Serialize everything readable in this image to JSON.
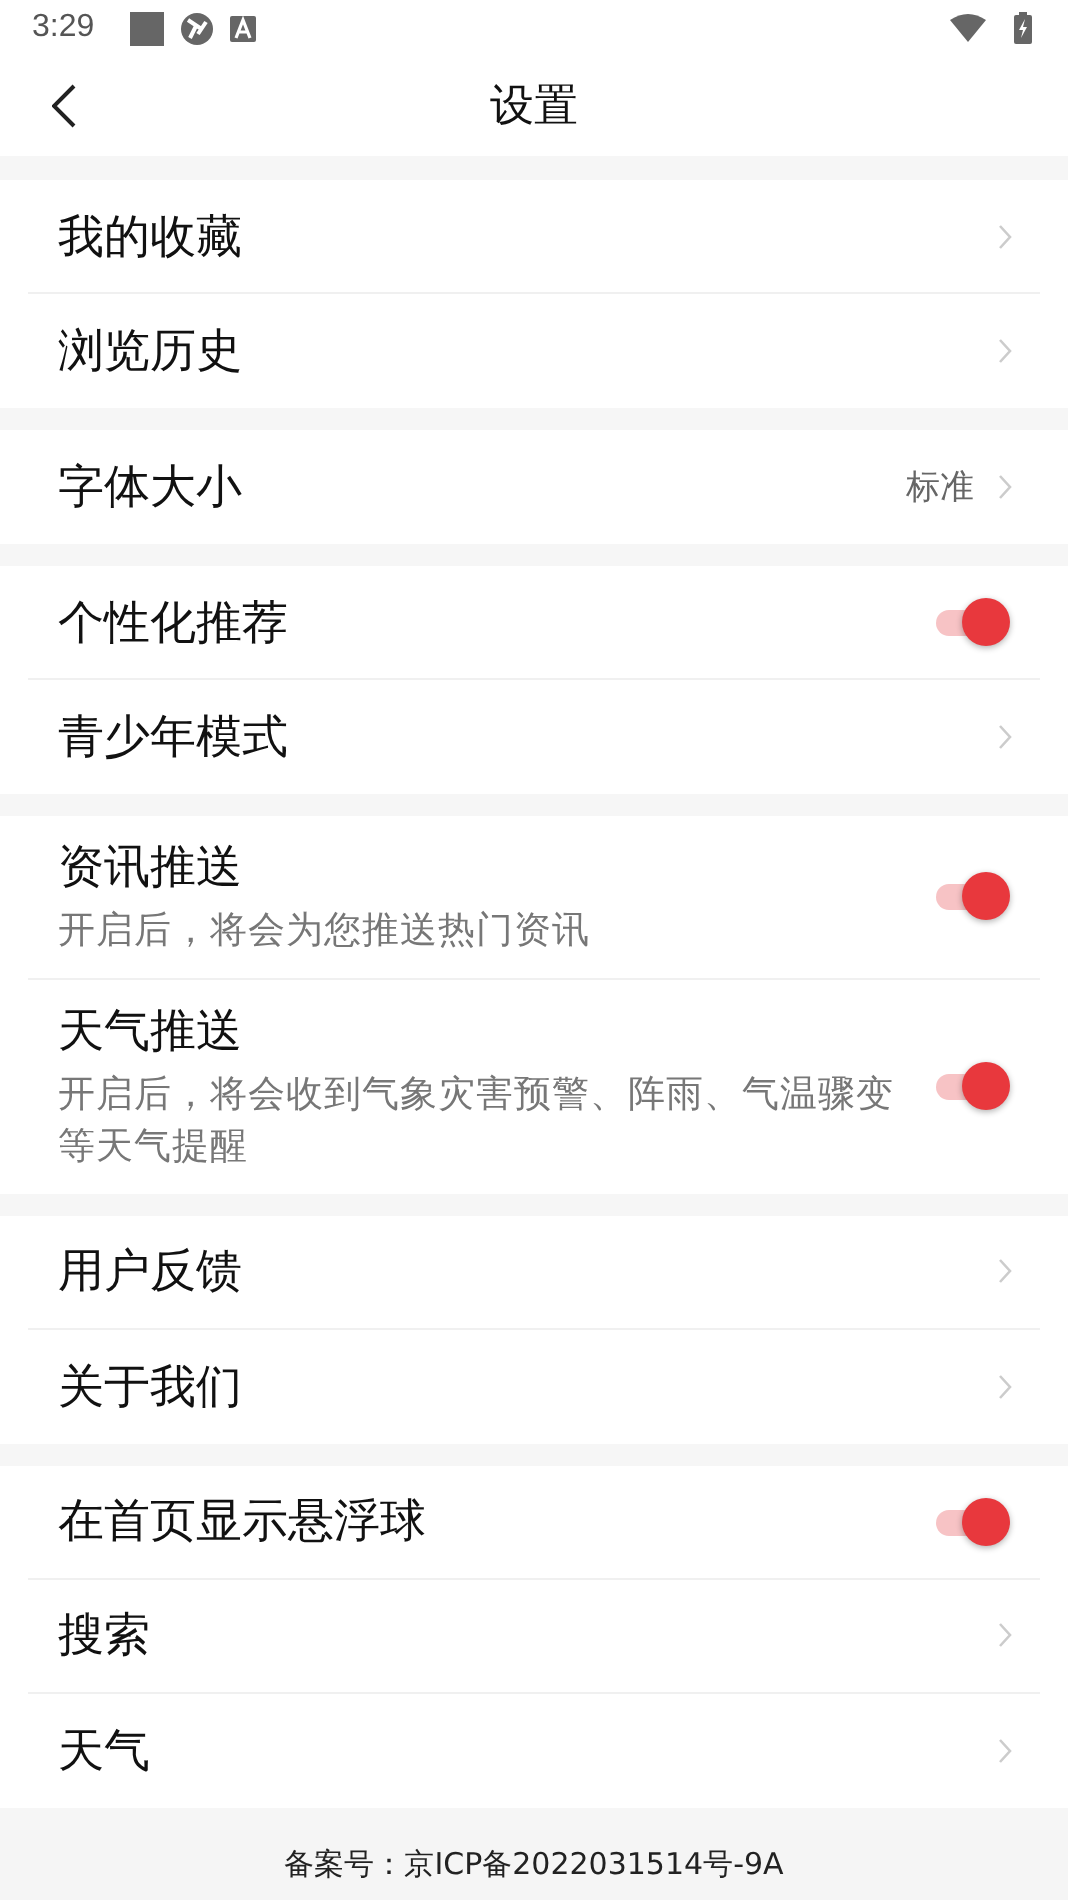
{
  "status_bar": {
    "time": "3:29"
  },
  "header": {
    "title": "设置"
  },
  "groups": [
    {
      "items": [
        {
          "kind": "link",
          "label": "我的收藏"
        },
        {
          "kind": "link",
          "label": "浏览历史"
        }
      ]
    },
    {
      "items": [
        {
          "kind": "link",
          "label": "字体大小",
          "value": "标准"
        }
      ]
    },
    {
      "items": [
        {
          "kind": "toggle",
          "label": "个性化推荐",
          "on": true
        },
        {
          "kind": "link",
          "label": "青少年模式"
        }
      ]
    },
    {
      "items": [
        {
          "kind": "toggle",
          "label": "资讯推送",
          "description": "开启后，将会为您推送热门资讯",
          "on": true
        },
        {
          "kind": "toggle",
          "label": "天气推送",
          "description": "开启后，将会收到气象灾害预警、阵雨、气温骤变等天气提醒",
          "on": true
        }
      ]
    },
    {
      "items": [
        {
          "kind": "link",
          "label": "用户反馈"
        },
        {
          "kind": "link",
          "label": "关于我们"
        }
      ]
    },
    {
      "items": [
        {
          "kind": "toggle",
          "label": "在首页显示悬浮球",
          "on": true
        },
        {
          "kind": "link",
          "label": "搜索"
        },
        {
          "kind": "link",
          "label": "天气"
        }
      ]
    }
  ],
  "footer": {
    "text": "备案号：京ICP备2022031514号-9A"
  }
}
